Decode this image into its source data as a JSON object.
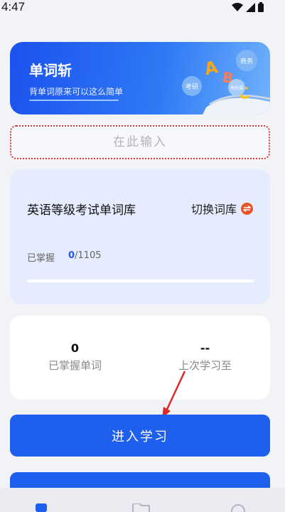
{
  "status_bar": {
    "time": "4:47"
  },
  "banner": {
    "title": "单词斩",
    "subtitle": "背单词原来可以这么简单",
    "bubble_labels": [
      "商务",
      "考研",
      "考托福"
    ]
  },
  "search": {
    "placeholder": "在此输入",
    "value": ""
  },
  "library": {
    "name": "英语等级考试单词库",
    "switch_label": "切换词库",
    "mastered_label": "已掌握",
    "mastered_count": "0",
    "total_count": "/1105",
    "progress_fraction": 0.0
  },
  "stats": {
    "mastered_words": {
      "value": "0",
      "label": "已掌握单词"
    },
    "last_study": {
      "value": "--",
      "label": "上次学习至"
    }
  },
  "actions": {
    "start_learning": "进入学习"
  },
  "colors": {
    "primary": "#1f5fed",
    "switch_icon": "#e8542a",
    "search_border": "#d93838"
  }
}
